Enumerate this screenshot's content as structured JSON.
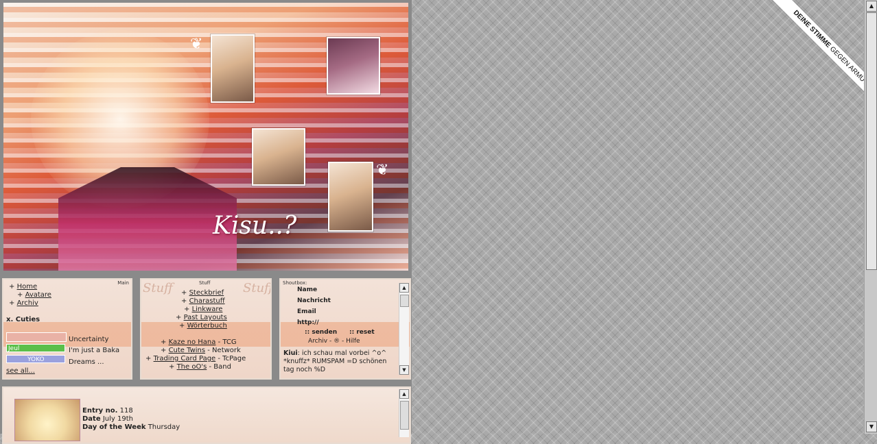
{
  "header": {
    "title": "Kisu..?"
  },
  "main": {
    "tag": "Main",
    "nav": [
      {
        "label": "Home"
      },
      {
        "label": "Avatare"
      },
      {
        "label": "Archiv"
      }
    ],
    "cuties_heading": "x. Cuties",
    "cuties": [
      {
        "label": "Uncertainty",
        "color": "#e9b2a6"
      },
      {
        "label": "I'm just a Baka",
        "color": "#5bbf4a",
        "badge": "Jeul"
      },
      {
        "label": "Dreams ...",
        "color": "#9aa1de",
        "badge": "YOKO"
      }
    ],
    "see_all": "see all..."
  },
  "stuff": {
    "tag": "Stuff",
    "bg_word": "Stuff",
    "links": [
      {
        "label": "Steckbrief"
      },
      {
        "label": "Charastuff"
      },
      {
        "label": "Linkware"
      },
      {
        "label": "Past Layouts"
      },
      {
        "label": "Wörterbuch"
      }
    ],
    "network": [
      {
        "label": "Kaze no Hana",
        "suffix": " - TCG"
      },
      {
        "label": "Cute Twins",
        "suffix": " - Network"
      },
      {
        "label": "Trading Card Page",
        "suffix": " - TcPage"
      },
      {
        "label": "The oO's",
        "suffix": " - Band"
      }
    ]
  },
  "shoutbox": {
    "tag": "Shoutbox:",
    "fields": {
      "name": "Name",
      "message": "Nachricht",
      "email": "Email",
      "url": "http://"
    },
    "send": ":: senden",
    "reset": ":: reset",
    "footer": "Archiv - ® - Hilfe",
    "message_author": "Kiui",
    "message_text": "ich schau mal vorbei ^o^ *knuffz* RUMSPAM =D schönen tag noch %D"
  },
  "entry": {
    "number_label": "Entry no.",
    "number": "118",
    "date_label": "Date",
    "date": "July 19th",
    "weekday_label": "Day of the Week",
    "weekday": "Thursday"
  },
  "ribbon": {
    "bold": "DEINE STIMME",
    "rest": "GEGEN ARMUT"
  },
  "colors": {
    "accent": "#d84b33",
    "panel_bg": "#f3e2d8",
    "page_bg": "#a9a9a9"
  }
}
